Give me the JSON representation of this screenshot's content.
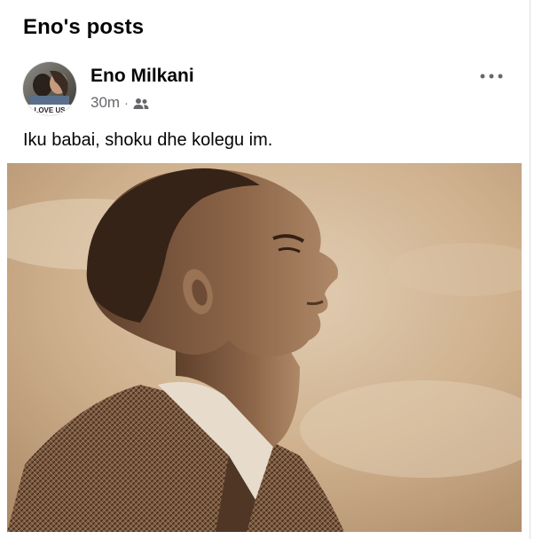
{
  "section": {
    "title": "Eno's posts"
  },
  "post": {
    "author": "Eno Milkani",
    "timestamp": "30m",
    "separator": "·",
    "audience_icon": "friends-icon",
    "more_icon": "more-horizontal-icon",
    "text": "Iku babai, shoku dhe kolegu im.",
    "avatar_caption": "LOVE US"
  },
  "colors": {
    "text_primary": "#050505",
    "text_secondary": "#65676b",
    "sepia_light": "#d7bc9a",
    "sepia_dark": "#3a2416"
  }
}
